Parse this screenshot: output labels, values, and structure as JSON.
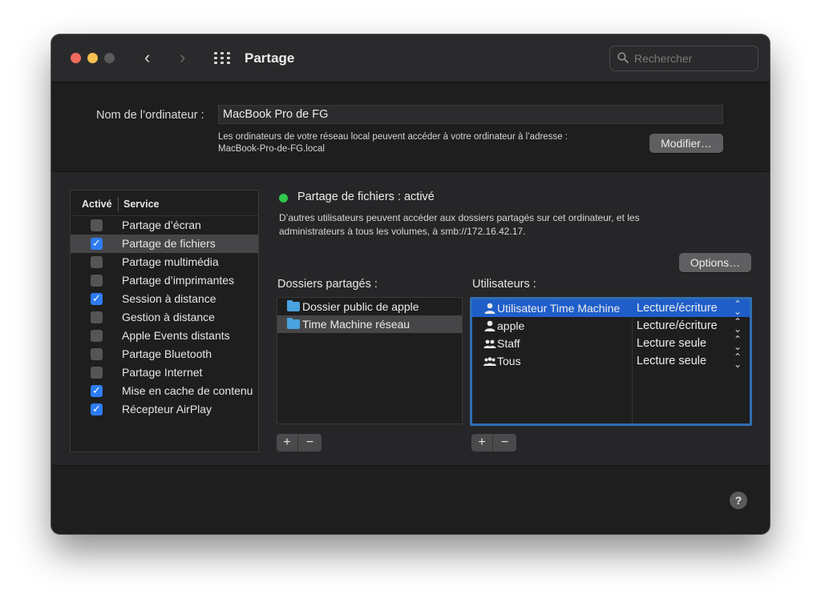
{
  "window": {
    "title": "Partage"
  },
  "search": {
    "placeholder": "Rechercher"
  },
  "computer_name": {
    "label": "Nom de l’ordinateur :",
    "value": "MacBook Pro de FG",
    "address_text_1": "Les ordinateurs de votre réseau local peuvent accéder à votre ordinateur à l’adresse :",
    "address_text_2": "MacBook-Pro-de-FG.local",
    "modify_button": "Modifier…"
  },
  "services": {
    "header_enabled": "Activé",
    "header_service": "Service",
    "items": [
      {
        "label": "Partage d’écran",
        "checked": false,
        "selected": false
      },
      {
        "label": "Partage de fichiers",
        "checked": true,
        "selected": true
      },
      {
        "label": "Partage multimédia",
        "checked": false,
        "selected": false
      },
      {
        "label": "Partage d’imprimantes",
        "checked": false,
        "selected": false
      },
      {
        "label": "Session à distance",
        "checked": true,
        "selected": false
      },
      {
        "label": "Gestion à distance",
        "checked": false,
        "selected": false
      },
      {
        "label": "Apple Events distants",
        "checked": false,
        "selected": false
      },
      {
        "label": "Partage Bluetooth",
        "checked": false,
        "selected": false
      },
      {
        "label": "Partage Internet",
        "checked": false,
        "selected": false
      },
      {
        "label": "Mise en cache de contenu",
        "checked": true,
        "selected": false
      },
      {
        "label": "Récepteur AirPlay",
        "checked": true,
        "selected": false
      }
    ]
  },
  "status": {
    "title": "Partage de fichiers : activé",
    "description_1": "D’autres utilisateurs peuvent accéder aux dossiers partagés sur cet ordinateur, et les",
    "description_2": "administrateurs à tous les volumes, à smb://172.16.42.17.",
    "indicator_color": "#30c74c",
    "options_button": "Options…"
  },
  "shared_folders": {
    "title": "Dossiers partagés :",
    "items": [
      {
        "label": "Dossier public de apple",
        "selected": false
      },
      {
        "label": "Time Machine réseau",
        "selected": true
      }
    ]
  },
  "users": {
    "title": "Utilisateurs :",
    "items": [
      {
        "name": "Utilisateur Time Machine",
        "permission": "Lecture/écriture",
        "icon": "person-icon",
        "selected": true
      },
      {
        "name": "apple",
        "permission": "Lecture/écriture",
        "icon": "person-icon",
        "selected": false
      },
      {
        "name": "Staff",
        "permission": "Lecture seule",
        "icon": "group-icon",
        "selected": false
      },
      {
        "name": "Tous",
        "permission": "Lecture seule",
        "icon": "everyone-icon",
        "selected": false
      }
    ]
  },
  "controls": {
    "plus": "+",
    "minus": "−",
    "help": "?"
  },
  "colors": {
    "accent": "#2d7cf6",
    "selection": "#1f5ec9",
    "close": "#ed6a5e",
    "minimize": "#f5bf4f"
  }
}
